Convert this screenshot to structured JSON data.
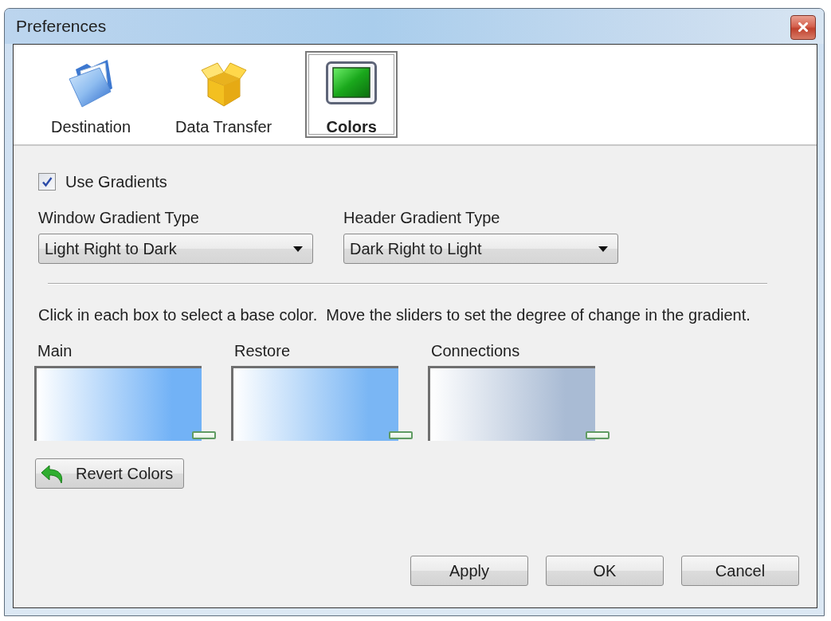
{
  "window": {
    "title": "Preferences"
  },
  "tabs": [
    {
      "label": "Destination",
      "kind": "folder",
      "selected": false
    },
    {
      "label": "Data Transfer",
      "kind": "package",
      "selected": false
    },
    {
      "label": "Colors",
      "kind": "swatch",
      "selected": true
    }
  ],
  "use_gradients": {
    "label": "Use Gradients",
    "checked": true
  },
  "gradient_types": [
    {
      "label": "Window Gradient Type",
      "value": "Light Right to Dark"
    },
    {
      "label": "Header Gradient Type",
      "value": "Dark Right to Light"
    }
  ],
  "instruction": "Click in each box to select a base color.  Move the sliders to set the degree of change in the gradient.",
  "color_boxes": [
    {
      "label": "Main",
      "color": "#72b2f6"
    },
    {
      "label": "Restore",
      "color": "#7ab6f4"
    },
    {
      "label": "Connections",
      "color": "#a9bbd4"
    }
  ],
  "revert_button": "Revert Colors",
  "buttons": [
    "Apply",
    "OK",
    "Cancel"
  ]
}
